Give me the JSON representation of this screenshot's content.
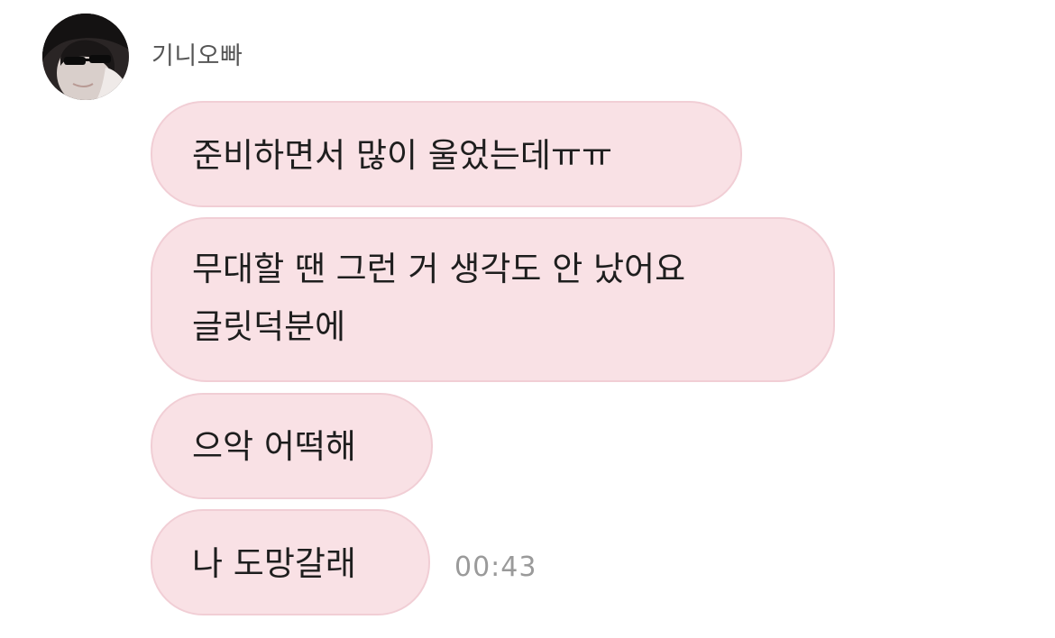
{
  "chat": {
    "sender": {
      "name": "기니오빠",
      "avatar_icon": "profile-photo-icon"
    },
    "messages": [
      {
        "lines": [
          "준비하면서 많이 울었는데ㅠㅠ"
        ]
      },
      {
        "lines": [
          "무대할 땐 그런 거 생각도 안 났어요",
          "글릿덕분에"
        ]
      },
      {
        "lines": [
          "으악 어떡해"
        ]
      },
      {
        "lines": [
          "나 도망갈래"
        ]
      }
    ],
    "timestamp": "00:43"
  },
  "colors": {
    "bubble_fill": "#f9e1e5",
    "bubble_border": "#f1ced5",
    "timestamp": "#9a9a9a",
    "sender_name": "#555555"
  }
}
